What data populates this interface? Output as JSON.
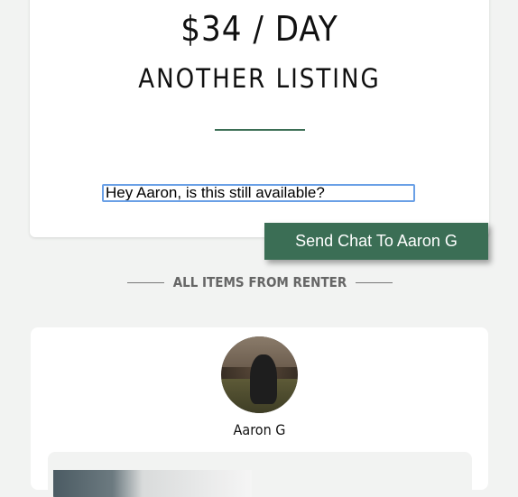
{
  "listing": {
    "price": "$34 / DAY",
    "title": "ANOTHER LISTING"
  },
  "chat": {
    "message": "Hey Aaron, is this still available?",
    "send_label": "Send Chat To Aaron G"
  },
  "section": {
    "label": "ALL ITEMS FROM RENTER"
  },
  "renter": {
    "name": "Aaron G"
  },
  "colors": {
    "accent": "#3b6e55",
    "background": "#f2f3f2",
    "input_focus": "#6aa0e6"
  }
}
